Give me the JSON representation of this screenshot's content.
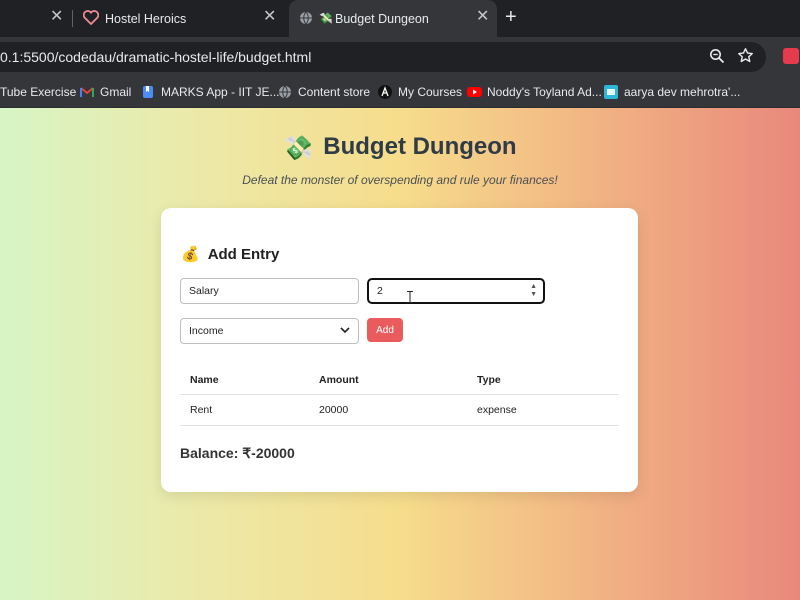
{
  "browser": {
    "tabs": [
      {
        "title": "",
        "active": false
      },
      {
        "title": "Hostel Heroics",
        "active": false
      },
      {
        "title": "Budget Dungeon",
        "active": true
      }
    ],
    "url": "0.1:5500/codedau/dramatic-hostel-life/budget.html",
    "bookmarks": [
      {
        "label": "Tube Exercise",
        "icon": "none"
      },
      {
        "label": "Gmail",
        "icon": "gmail-icon"
      },
      {
        "label": "MARKS App - IIT JE...",
        "icon": "bookmark-blue-icon"
      },
      {
        "label": "Content store",
        "icon": "globe-icon"
      },
      {
        "label": "My Courses",
        "icon": "a-logo-icon"
      },
      {
        "label": "Noddy's Toyland Ad...",
        "icon": "youtube-icon"
      },
      {
        "label": "aarya dev mehrotra'...",
        "icon": "site-icon"
      }
    ]
  },
  "page": {
    "title_emoji": "💸",
    "title": "Budget Dungeon",
    "subtitle": "Defeat the monster of overspending and rule your finances!"
  },
  "card": {
    "heading_emoji": "💰",
    "heading": "Add Entry",
    "name_value": "Salary",
    "amount_value": "2",
    "type_value": "Income",
    "add_label": "Add",
    "table": {
      "headers": [
        "Name",
        "Amount",
        "Type"
      ],
      "rows": [
        {
          "name": "Rent",
          "amount": "20000",
          "type": "expense"
        }
      ]
    },
    "balance": "Balance: ₹-20000"
  },
  "colors": {
    "accent": "#ea5b5e",
    "title_text": "#2f3b47",
    "gradient": [
      "#d7f5c5",
      "#f6dd8c",
      "#e9887c"
    ]
  }
}
